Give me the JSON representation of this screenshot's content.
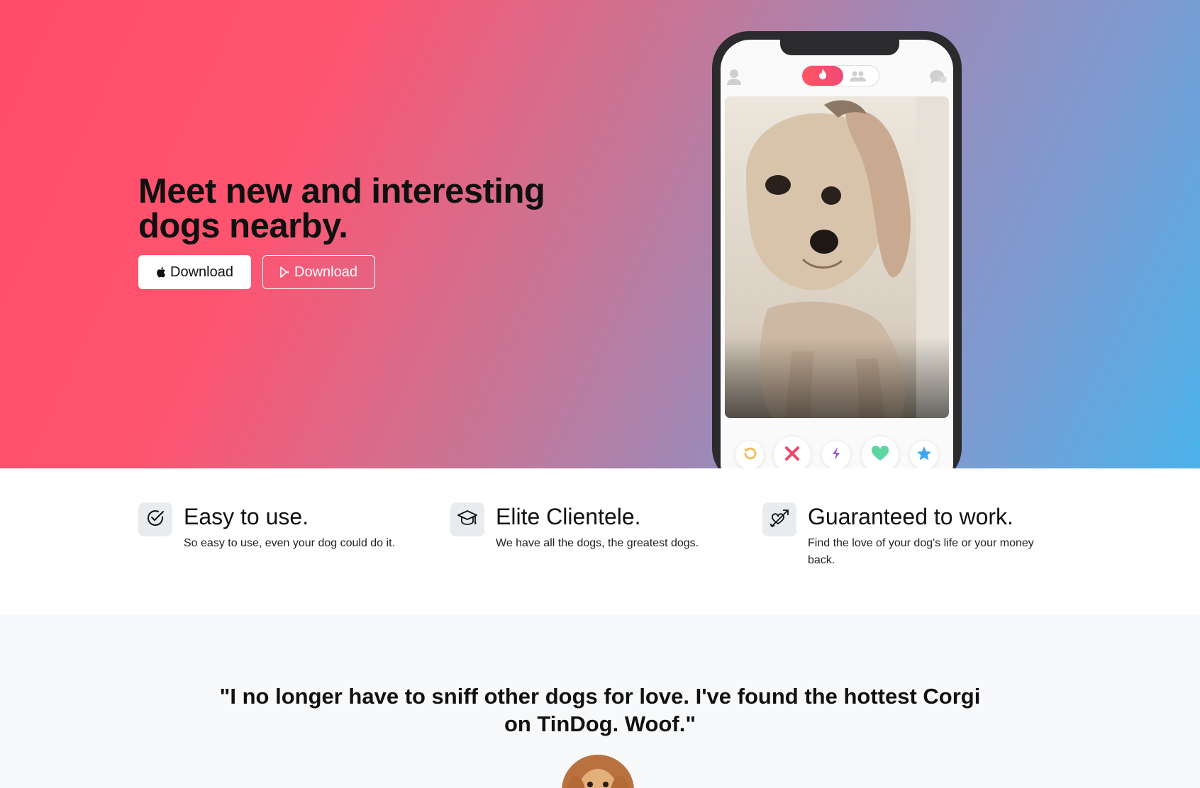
{
  "hero": {
    "title": "Meet new and interesting dogs nearby.",
    "buttons": {
      "apple_label": "Download",
      "play_label": "Download"
    }
  },
  "phone": {
    "header_icons": [
      "profile-icon",
      "flame-icon",
      "group-icon",
      "chat-icon"
    ],
    "actions": [
      "rewind-icon",
      "nope-icon",
      "boost-icon",
      "like-icon",
      "super-like-icon"
    ]
  },
  "features": [
    {
      "icon": "check-circle-icon",
      "title": "Easy to use.",
      "text": "So easy to use, even your dog could do it."
    },
    {
      "icon": "graduation-cap-icon",
      "title": "Elite Clientele.",
      "text": "We have all the dogs, the greatest dogs."
    },
    {
      "icon": "heart-arrow-icon",
      "title": "Guaranteed to work.",
      "text": "Find the love of your dog's life or your money back."
    }
  ],
  "testimonial": {
    "quote": "\"I no longer have to sniff other dogs for love. I've found the hottest Corgi on TinDog. Woof.\""
  },
  "colors": {
    "gradient_start": "#ff4c68",
    "gradient_end": "#4cb3eb",
    "brand_pink": "#fd5564"
  }
}
